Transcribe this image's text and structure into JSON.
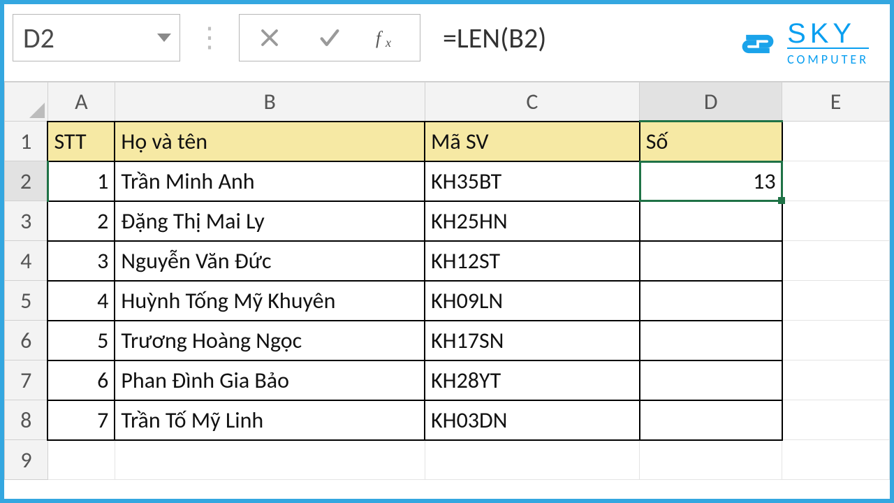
{
  "namebox": {
    "value": "D2"
  },
  "formula": {
    "value": "=LEN(B2)"
  },
  "logo": {
    "top": "SKY",
    "bottom": "COMPUTER"
  },
  "columns": [
    "A",
    "B",
    "C",
    "D",
    "E"
  ],
  "rownums": [
    "1",
    "2",
    "3",
    "4",
    "5",
    "6",
    "7",
    "8",
    "9"
  ],
  "headers": {
    "A": "STT",
    "B": "Họ và tên",
    "C": "Mã SV",
    "D": "Số"
  },
  "rows": [
    {
      "stt": "1",
      "name": "Trần Minh Anh",
      "code": "KH35BT",
      "num": "13"
    },
    {
      "stt": "2",
      "name": "Đặng Thị Mai Ly",
      "code": "KH25HN",
      "num": ""
    },
    {
      "stt": "3",
      "name": "Nguyễn Văn Đức",
      "code": "KH12ST",
      "num": ""
    },
    {
      "stt": "4",
      "name": "Huỳnh Tống Mỹ Khuyên",
      "code": "KH09LN",
      "num": ""
    },
    {
      "stt": "5",
      "name": "Trương Hoàng Ngọc",
      "code": "KH17SN",
      "num": ""
    },
    {
      "stt": "6",
      "name": "Phan Đình Gia Bảo",
      "code": "KH28YT",
      "num": ""
    },
    {
      "stt": "7",
      "name": "Trần Tố Mỹ Linh",
      "code": "KH03DN",
      "num": ""
    }
  ],
  "active_cell": "D2"
}
